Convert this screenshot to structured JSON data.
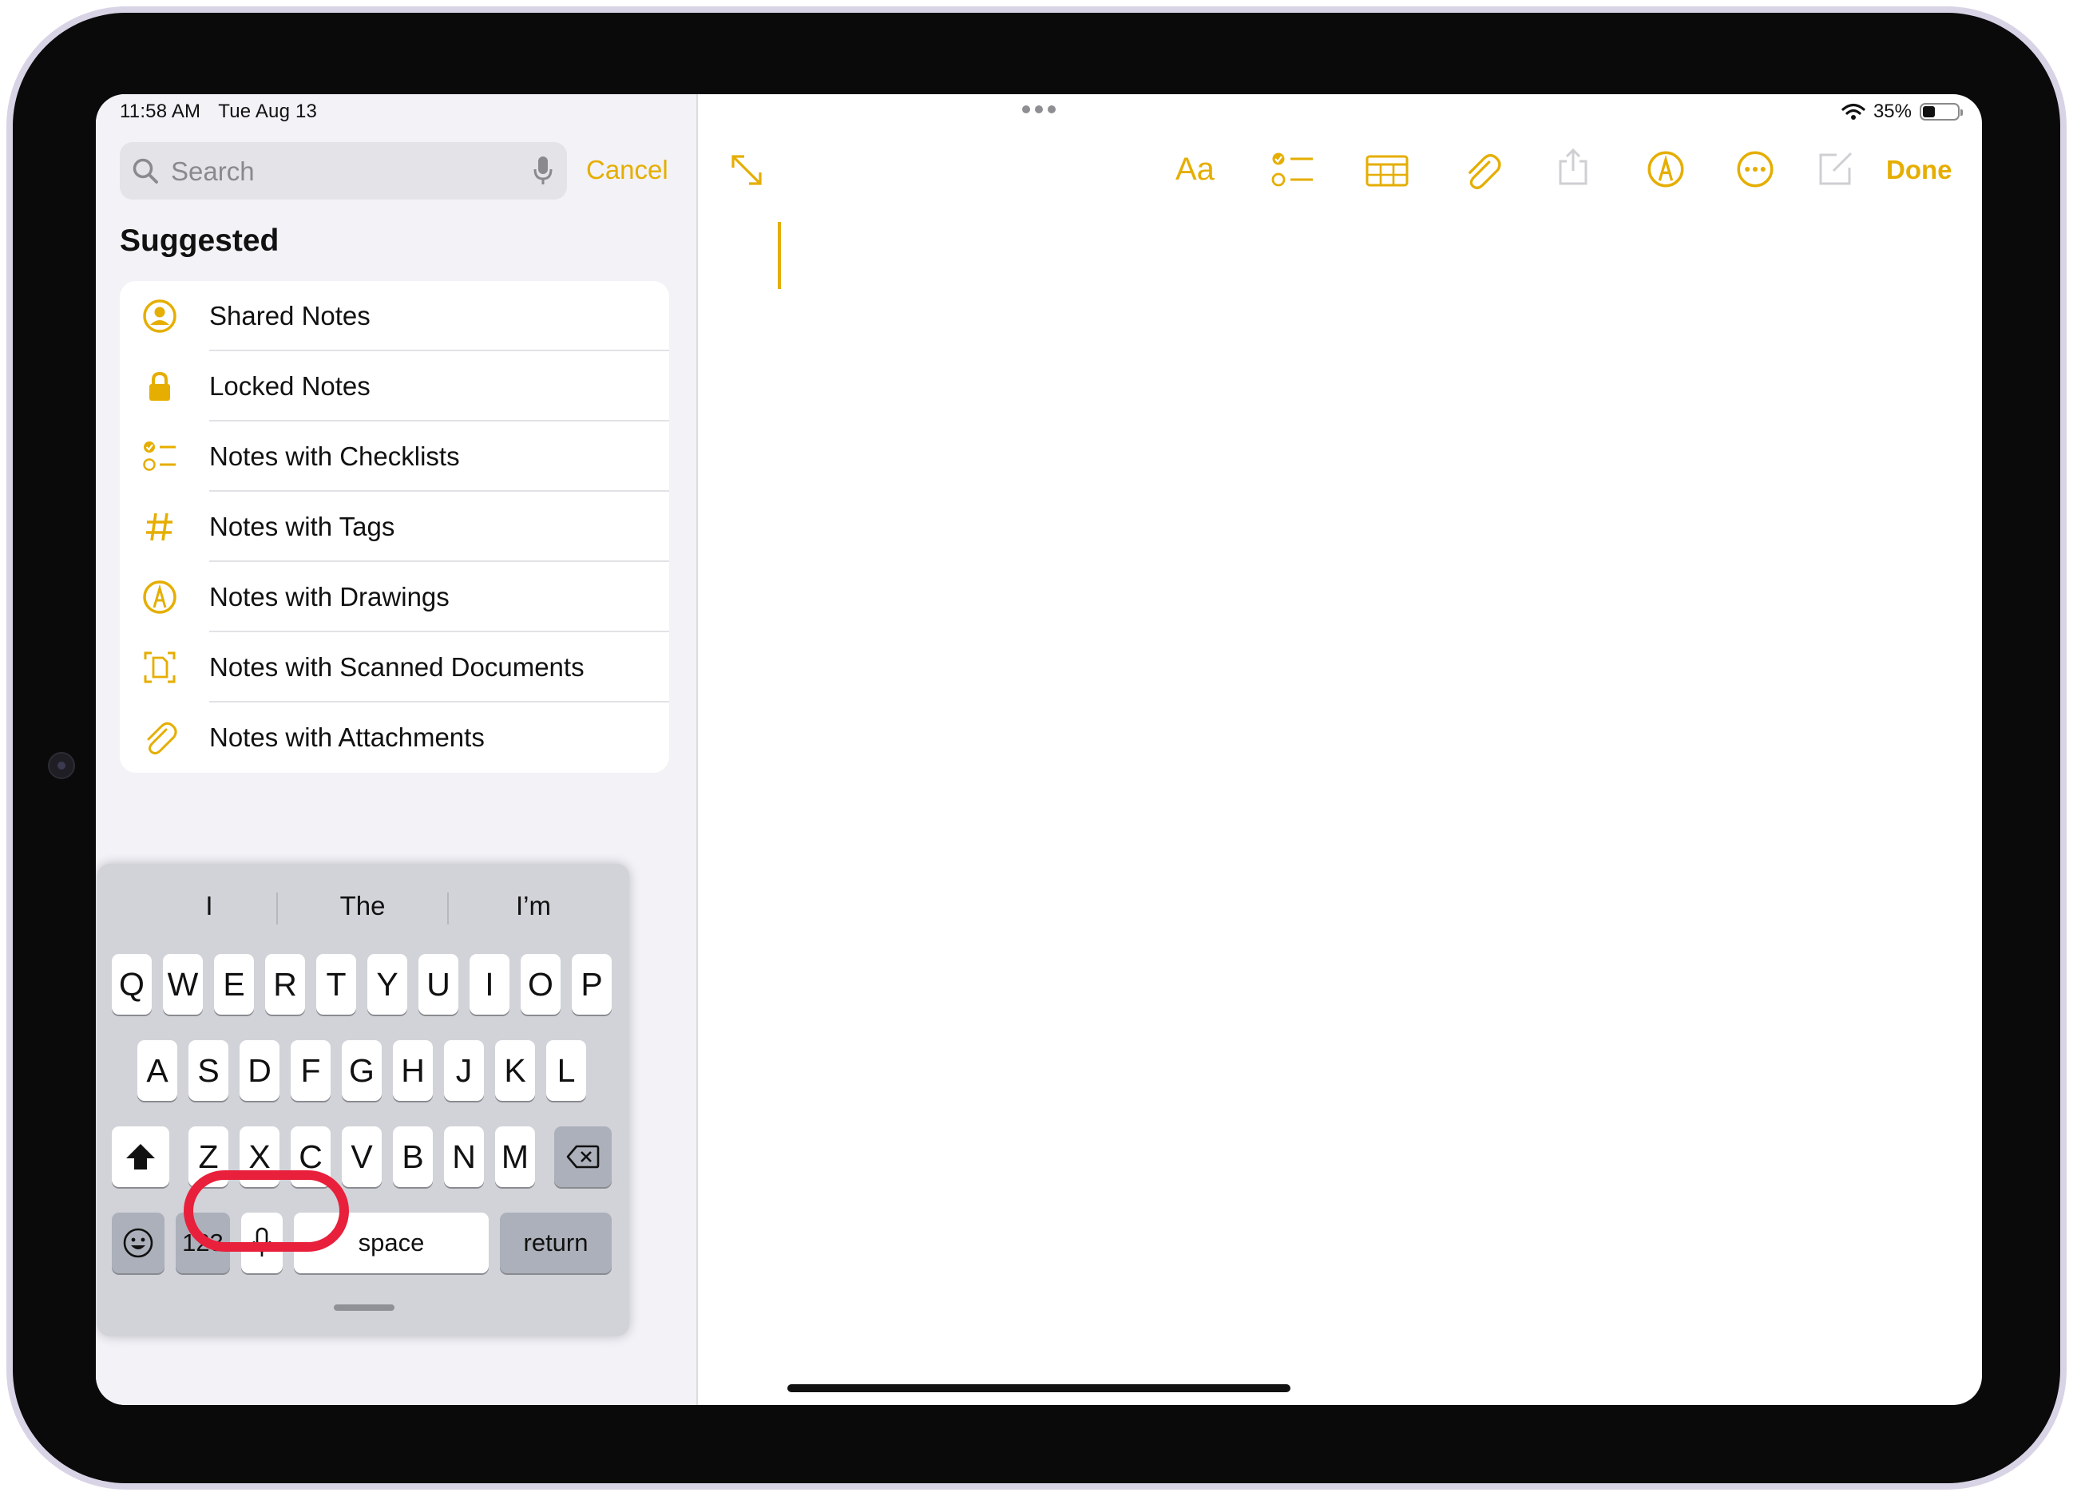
{
  "status_bar": {
    "time": "11:58 AM",
    "date": "Tue Aug 13",
    "battery_text": "35%",
    "battery_level": 0.35
  },
  "search": {
    "placeholder": "Search",
    "value": "",
    "cancel_label": "Cancel"
  },
  "suggested": {
    "title": "Suggested",
    "items": [
      {
        "label": "Shared Notes",
        "icon": "person-circle-icon"
      },
      {
        "label": "Locked Notes",
        "icon": "lock-icon"
      },
      {
        "label": "Notes with Checklists",
        "icon": "checklist-icon"
      },
      {
        "label": "Notes with Tags",
        "icon": "hashtag-icon"
      },
      {
        "label": "Notes with Drawings",
        "icon": "pen-circle-icon"
      },
      {
        "label": "Notes with Scanned Documents",
        "icon": "scan-document-icon"
      },
      {
        "label": "Notes with Attachments",
        "icon": "paperclip-icon"
      }
    ]
  },
  "toolbar": {
    "format_label": "Aa",
    "done_label": "Done",
    "icons": [
      "expand-icon",
      "checklist-icon",
      "table-icon",
      "paperclip-icon",
      "share-icon",
      "markup-icon",
      "more-icon",
      "compose-icon"
    ]
  },
  "keyboard": {
    "predictions": [
      "I",
      "The",
      "I’m"
    ],
    "row1": [
      "Q",
      "W",
      "E",
      "R",
      "T",
      "Y",
      "U",
      "I",
      "O",
      "P"
    ],
    "row2": [
      "A",
      "S",
      "D",
      "F",
      "G",
      "H",
      "J",
      "K",
      "L"
    ],
    "row3": [
      "Z",
      "X",
      "C",
      "V",
      "B",
      "N",
      "M"
    ],
    "numbers_label": "123",
    "space_label": "space",
    "return_label": "return"
  },
  "colors": {
    "accent": "#e5ae00",
    "highlight": "#e8203b",
    "sidebar_bg": "#f2f2f7",
    "keyboard_bg": "#d1d3d9"
  }
}
